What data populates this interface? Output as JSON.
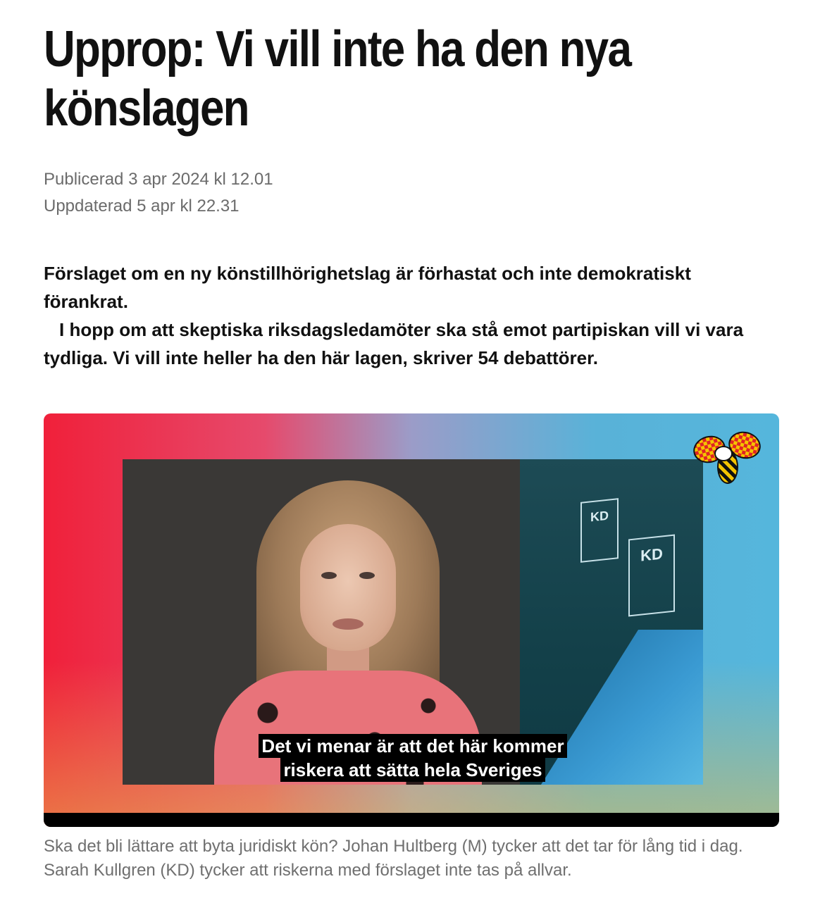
{
  "article": {
    "headline": "Upprop: Vi vill inte ha den nya könslagen",
    "published": "Publicerad 3 apr 2024 kl 12.01",
    "updated": "Uppdaterad 5 apr kl 22.31",
    "lead_1": "Förslaget om en ny könstillhörighetslag är förhastat och inte demokratiskt förankrat.",
    "lead_2": "I hopp om att skeptiska riksdagsledamöter ska stå emot partipiskan vill vi vara tydliga. Vi vill inte heller ha den här lagen, skriver 54 debattörer."
  },
  "video": {
    "sign_1": "KD",
    "sign_2": "KD",
    "subtitle_line_1": "Det vi menar är att det här kommer",
    "subtitle_line_2": "riskera att sätta hela Sveriges",
    "logo_icon": "wasp-logo-icon"
  },
  "caption": "Ska det bli lättare att byta juridiskt kön? Johan Hultberg (M) tycker att det tar för lång tid i dag. Sarah Kullgren (KD) tycker att riskerna med förslaget inte tas på allvar."
}
